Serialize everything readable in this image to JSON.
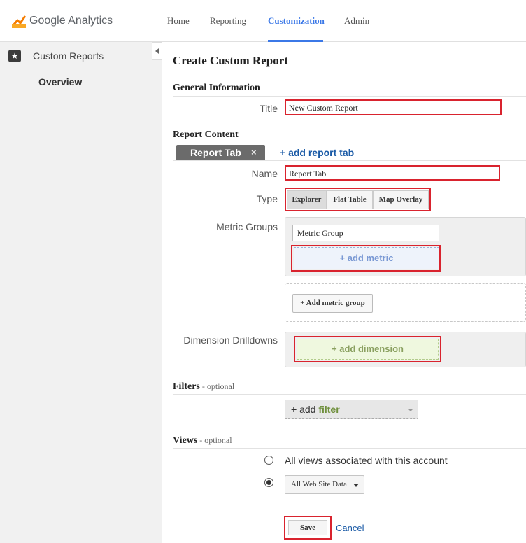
{
  "app": {
    "logo_text": "Google Analytics"
  },
  "nav": {
    "home": "Home",
    "reporting": "Reporting",
    "customization": "Customization",
    "admin": "Admin"
  },
  "sidebar": {
    "section_label": "Custom Reports",
    "item_overview": "Overview"
  },
  "page": {
    "title": "Create Custom Report"
  },
  "general": {
    "heading": "General Information",
    "title_label": "Title",
    "title_value": "New Custom Report"
  },
  "report_content": {
    "heading": "Report Content",
    "tab_label": "Report Tab",
    "tab_close": "×",
    "add_tab": "+ add report tab",
    "name_label": "Name",
    "name_value": "Report Tab",
    "type_label": "Type",
    "types": [
      "Explorer",
      "Flat Table",
      "Map Overlay"
    ],
    "selected_type": "Explorer",
    "metric_groups_label": "Metric Groups",
    "metric_group_value": "Metric Group",
    "add_metric": "+ add metric",
    "add_metric_group": "+ Add metric group",
    "dimension_label": "Dimension Drilldowns",
    "add_dimension": "+ add dimension"
  },
  "filters": {
    "heading": "Filters",
    "optional": " - optional",
    "add_prefix": "+",
    "add_word": " add ",
    "add_keyword": "filter"
  },
  "views": {
    "heading": "Views",
    "optional": " - optional",
    "option_all": "All views associated with this account",
    "selected_view": "All Web Site Data"
  },
  "actions": {
    "save": "Save",
    "cancel": "Cancel"
  },
  "colors": {
    "accent": "#3b78e7",
    "highlight_border": "#d9232e",
    "link": "#1a5aa6"
  }
}
